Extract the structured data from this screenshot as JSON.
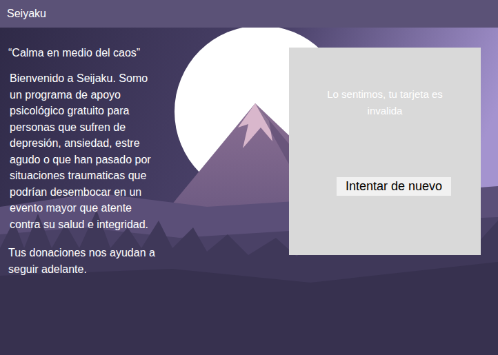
{
  "header": {
    "title": "Seiyaku"
  },
  "quote": "“Calma en medio del caos”",
  "intro_lines": [
    "Bienvenido a Seijaku. Somo",
    "un programa de apoyo",
    "psicológico gratuito para",
    "personas que sufren de",
    "depresión, ansiedad, estre",
    "agudo o que han pasado por",
    "situaciones traumaticas que",
    "podrían desembocar en un",
    "evento mayor que atente",
    "contra su salud e integridad."
  ],
  "donation_lines": [
    "Tus donaciones nos ayudan a",
    "seguir adelante."
  ],
  "dialog": {
    "message": "Lo sentimos, tu tarjeta es invalida",
    "button": "Intentar de nuevo"
  }
}
